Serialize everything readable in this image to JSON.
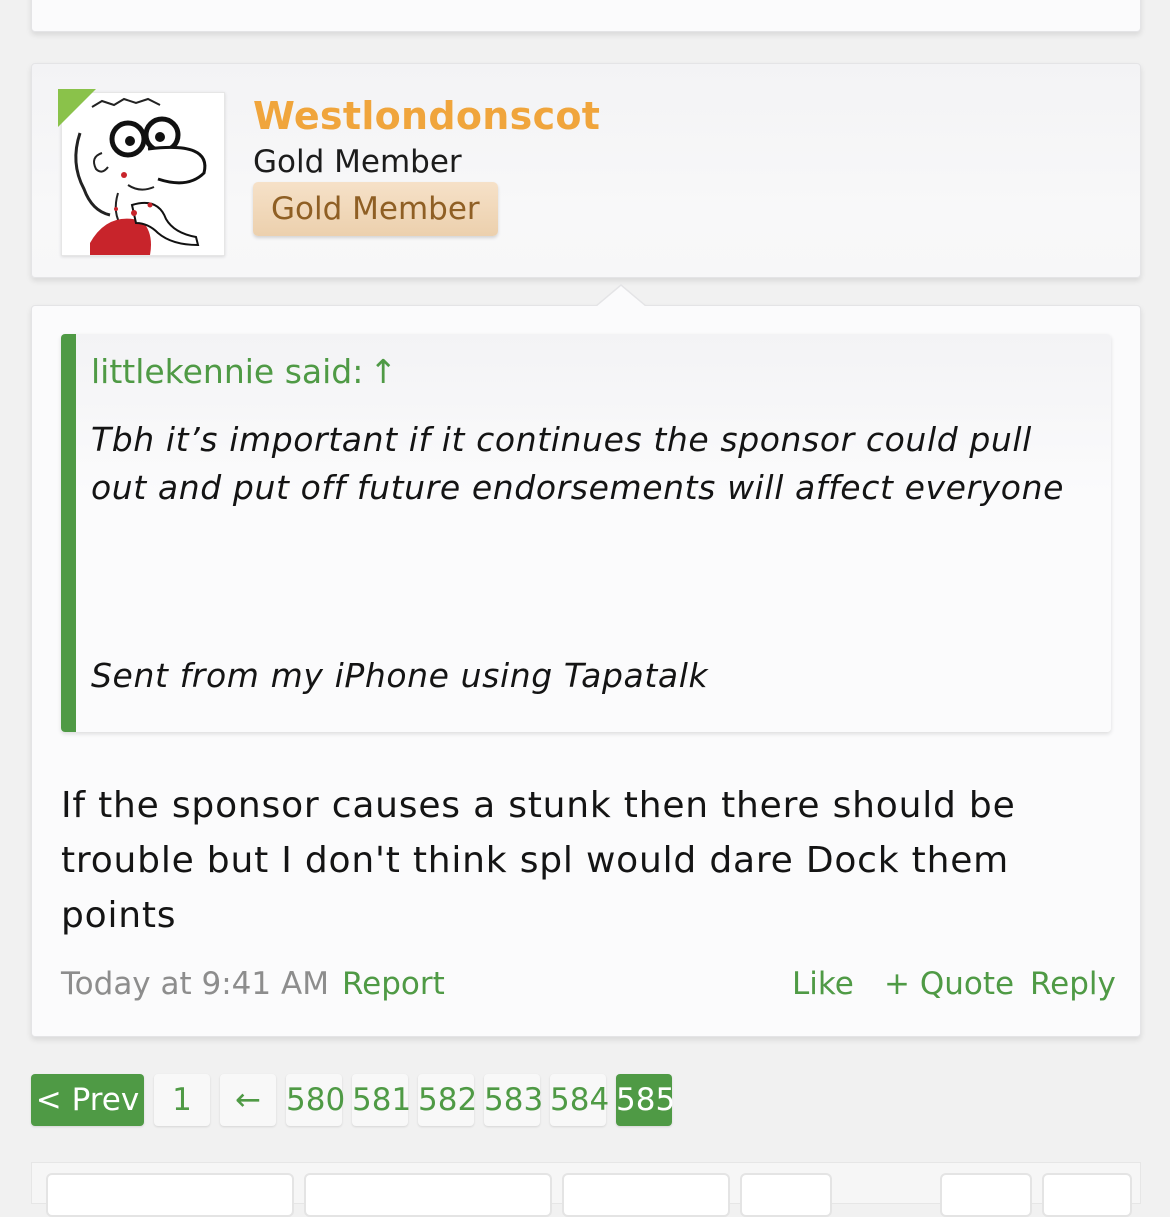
{
  "user": {
    "name": "Westlondonscot",
    "title": "Gold Member",
    "badge": "Gold Member",
    "online_color": "#8ac24a",
    "avatar_icon": "cartoon-face-avatar"
  },
  "quote": {
    "attribution": "littlekennie said:",
    "jump_icon": "↑",
    "text": "Tbh it’s important if it continues the sponsor could pull out and put off future endorsements will affect everyone",
    "signature": "Sent from my iPhone using Tapatalk"
  },
  "post": {
    "body": "If the sponsor causes a stunk then there should be trouble but I don't think spl would dare Dock them points"
  },
  "meta": {
    "time": "Today at 9:41 AM",
    "report": "Report",
    "like": "Like",
    "quote": "+ Quote",
    "reply": "Reply"
  },
  "pagination": {
    "prev": "< Prev",
    "first": "1",
    "skip": "←",
    "pages": [
      "580",
      "581",
      "582",
      "583",
      "584",
      "585"
    ],
    "current": "585"
  },
  "colors": {
    "accent": "#4f9a45",
    "username": "#f0a53c",
    "badge_text": "#8f5f24"
  }
}
